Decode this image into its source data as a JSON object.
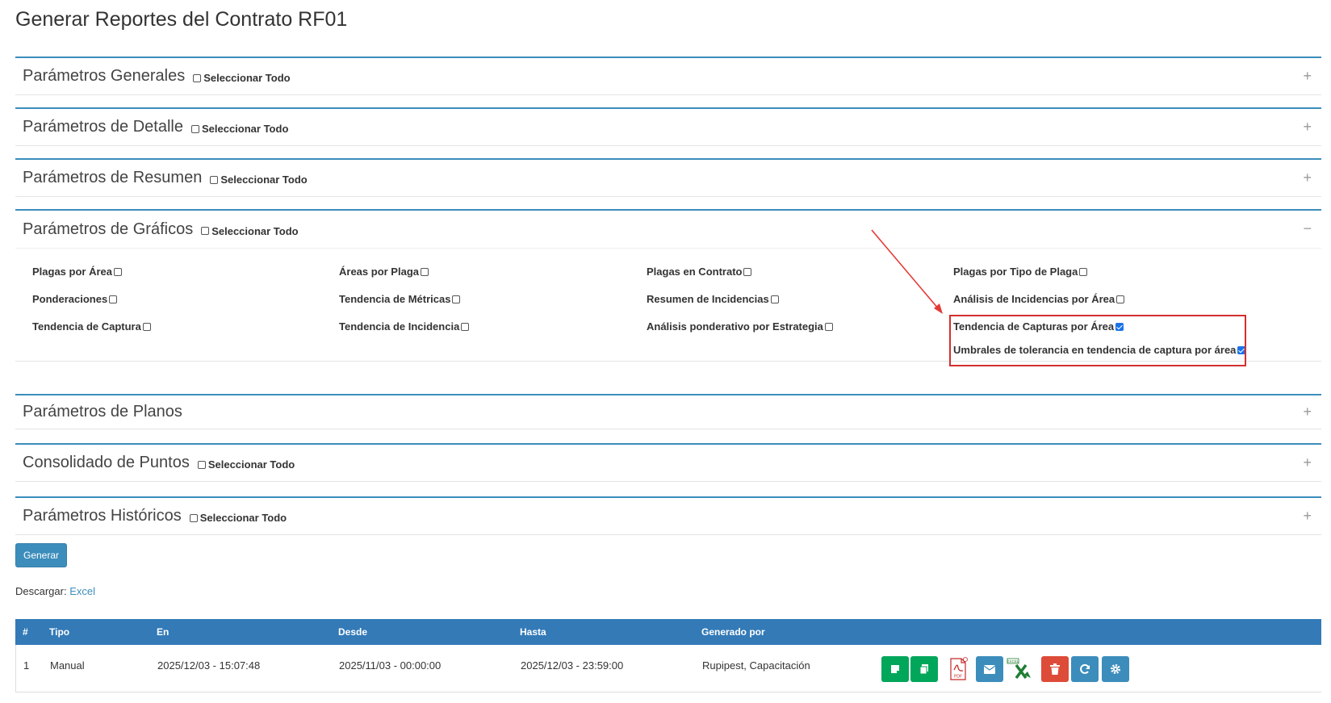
{
  "page_title": "Generar Reportes del Contrato RF01",
  "select_all_label": "Seleccionar Todo",
  "panels": {
    "generales": {
      "title": "Parámetros Generales",
      "toggle": "+"
    },
    "detalle": {
      "title": "Parámetros de Detalle",
      "toggle": "+"
    },
    "resumen": {
      "title": "Parámetros de Resumen",
      "toggle": "+"
    },
    "graficos": {
      "title": "Parámetros de Gráficos",
      "toggle": "−"
    },
    "planos": {
      "title": "Parámetros de Planos",
      "toggle": "+"
    },
    "consolidado": {
      "title": "Consolidado de Puntos",
      "toggle": "+"
    },
    "historicos": {
      "title": "Parámetros Históricos",
      "toggle": "+"
    }
  },
  "graficos_options": [
    {
      "label": "Plagas por Área",
      "checked": false
    },
    {
      "label": "Áreas por Plaga",
      "checked": false
    },
    {
      "label": "Plagas en Contrato",
      "checked": false
    },
    {
      "label": "Plagas por Tipo de Plaga",
      "checked": false
    },
    {
      "label": "Ponderaciones",
      "checked": false
    },
    {
      "label": "Tendencia de Métricas",
      "checked": false
    },
    {
      "label": "Resumen de Incidencias",
      "checked": false
    },
    {
      "label": "Análisis de Incidencias por Área",
      "checked": false
    },
    {
      "label": "Tendencia de Captura",
      "checked": false
    },
    {
      "label": "Tendencia de Incidencia",
      "checked": false
    },
    {
      "label": "Análisis ponderativo por Estrategia",
      "checked": false
    },
    {
      "label": "Tendencia de Capturas por Área",
      "checked": true
    },
    {
      "label": "Umbrales de tolerancia en tendencia de captura por área",
      "checked": true
    }
  ],
  "generar_label": "Generar",
  "download": {
    "prefix": "Descargar:",
    "link": "Excel"
  },
  "table": {
    "headers": [
      "#",
      "Tipo",
      "En",
      "Desde",
      "Hasta",
      "Generado por"
    ],
    "rows": [
      {
        "num": "1",
        "tipo": "Manual",
        "en": "2025/12/03 - 15:07:48",
        "desde": "2025/11/03 - 00:00:00",
        "hasta": "2025/12/03 - 23:59:00",
        "generado_por": "Rupipest, Capacitación"
      }
    ]
  },
  "colors": {
    "accent": "#3c8dbc",
    "green": "#00a65a",
    "red": "#dd4b39",
    "highlight": "#d32f2f"
  }
}
